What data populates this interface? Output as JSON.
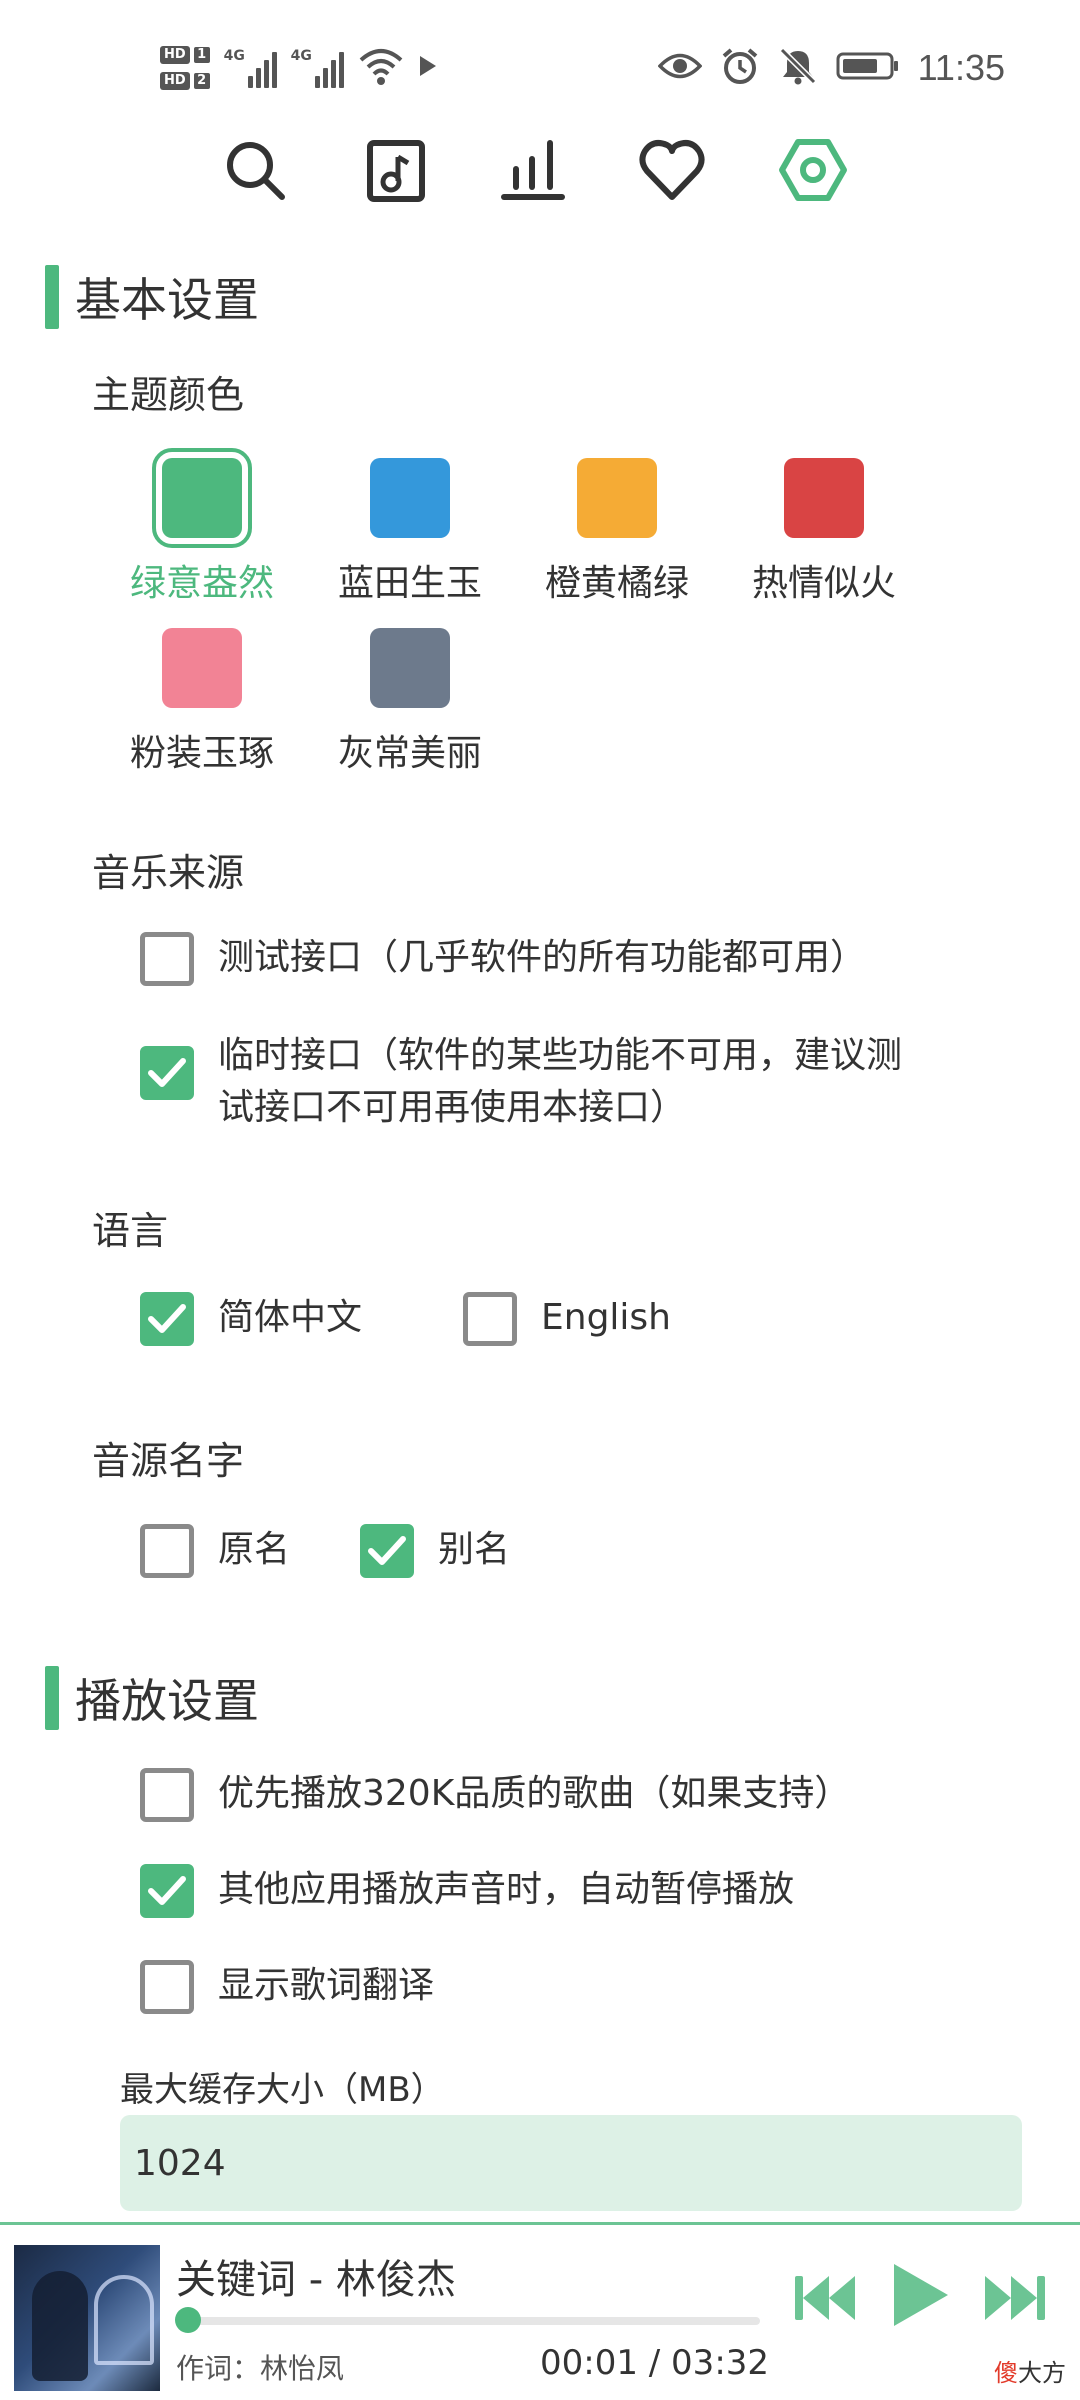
{
  "status_bar": {
    "hd1": "HD",
    "hd1_num": "1",
    "hd2": "HD",
    "hd2_num": "2",
    "net1": "4G",
    "net2": "4G",
    "time": "11:35"
  },
  "nav": {
    "items": [
      "search-icon",
      "music-file-icon",
      "chart-icon",
      "heart-icon",
      "settings-icon"
    ],
    "active": "settings-icon",
    "accent": "#4db87e"
  },
  "basic": {
    "title": "基本设置",
    "theme_label": "主题颜色",
    "themes": [
      {
        "label": "绿意盎然",
        "color": "#4db87e",
        "selected": true
      },
      {
        "label": "蓝田生玉",
        "color": "#3498db",
        "selected": false
      },
      {
        "label": "橙黄橘绿",
        "color": "#f5ab35",
        "selected": false
      },
      {
        "label": "热情似火",
        "color": "#d94444",
        "selected": false
      },
      {
        "label": "粉装玉琢",
        "color": "#f28395",
        "selected": false
      },
      {
        "label": "灰常美丽",
        "color": "#6d7a8c",
        "selected": false
      }
    ],
    "source_label": "音乐来源",
    "sources": [
      {
        "label": "测试接口（几乎软件的所有功能都可用）",
        "checked": false
      },
      {
        "label_line1": "临时接口（软件的某些功能不可用，建议测",
        "label_line2": "试接口不可用再使用本接口）",
        "checked": true
      }
    ],
    "language_label": "语言",
    "languages": [
      {
        "label": "简体中文",
        "checked": true
      },
      {
        "label": "English",
        "checked": false
      }
    ],
    "source_name_label": "音源名字",
    "source_names": [
      {
        "label": "原名",
        "checked": false
      },
      {
        "label": "别名",
        "checked": true
      }
    ]
  },
  "play": {
    "title": "播放设置",
    "options": [
      {
        "label": "优先播放320K品质的歌曲（如果支持）",
        "checked": false
      },
      {
        "label": "其他应用播放声音时，自动暂停播放",
        "checked": true
      },
      {
        "label": "显示歌词翻译",
        "checked": false
      }
    ],
    "cache_label": "最大缓存大小（MB）",
    "cache_value": "1024"
  },
  "player": {
    "song": "关键词 - 林俊杰",
    "lyricist": "作词：林怡凤",
    "time": "00:01 / 03:32",
    "progress": 0.005,
    "watermark_red": "傻",
    "watermark_rest": "大方"
  }
}
